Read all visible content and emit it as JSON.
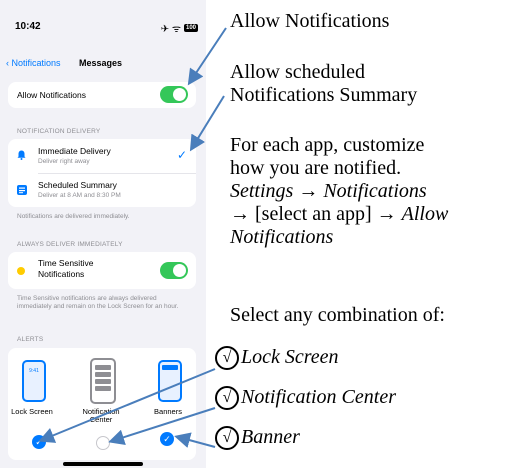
{
  "phone": {
    "status_bar": {
      "time": "10:42",
      "icons": "✈ ᯤ",
      "battery": "100"
    },
    "nav": {
      "back_label": "Notifications",
      "title": "Messages"
    },
    "allow_notifications": {
      "label": "Allow Notifications",
      "enabled": true
    },
    "delivery": {
      "header": "NOTIFICATION DELIVERY",
      "options": [
        {
          "label": "Immediate Delivery",
          "sub": "Deliver right away",
          "selected": true
        },
        {
          "label": "Scheduled Summary",
          "sub": "Deliver at 8 AM and 8:30 PM",
          "selected": false
        }
      ],
      "footer": "Notifications are delivered immediately."
    },
    "always": {
      "header": "ALWAYS DELIVER IMMEDIATELY",
      "label": "Time Sensitive Notifications",
      "enabled": true,
      "footer": "Time Sensitive notifications are always delivered immediately and remain on the Lock Screen for an hour."
    },
    "alerts": {
      "header": "ALERTS",
      "lock_time": "9:41",
      "items": [
        {
          "label": "Lock Screen",
          "checked": true
        },
        {
          "label": "Notification Center",
          "checked": false
        },
        {
          "label": "Banners",
          "checked": true
        }
      ]
    }
  },
  "annotations": {
    "a1": "Allow Notifications",
    "a2_line1": "Allow scheduled",
    "a2_line2": "Notifications Summary",
    "a3_line1": "For each app, customize",
    "a3_line2": "how you are notified.",
    "a3_settings": "Settings → Notifications",
    "a3_arrow": "→ ",
    "a3_select": "[select an app] → ",
    "a3_allow": "Allow",
    "a3_notif": "Notifications",
    "a4": "Select any combination of:",
    "check_mark": "√",
    "opt1": "Lock Screen",
    "opt2": "Notification Center",
    "opt3": "Banner"
  },
  "colors": {
    "accent": "#007aff",
    "toggle": "#34c759",
    "bell": "#007aff",
    "time_sensitive_dot": "#ffcc00"
  }
}
